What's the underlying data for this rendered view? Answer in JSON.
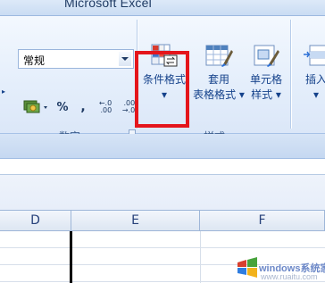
{
  "window": {
    "title": "Microsoft Excel"
  },
  "ribbon": {
    "number_group": {
      "format_value": "常规",
      "percent_label": "%",
      "comma_label": ",",
      "inc_decimal_top": "←.0",
      "inc_decimal_bottom": ".00",
      "dec_decimal_top": ".00",
      "dec_decimal_bottom": "→.0",
      "group_label": "数字"
    },
    "styles_group": {
      "conditional_formatting": {
        "label": "条件格式",
        "arrow": "▾"
      },
      "format_as_table": {
        "label_line1": "套用",
        "label_line2": "表格格式 ▾"
      },
      "cell_styles": {
        "label_line1": "单元格",
        "label_line2": "样式 ▾"
      },
      "group_label": "样式"
    },
    "cells_group": {
      "insert": {
        "label": "插入",
        "arrow": "▾"
      }
    },
    "highlight_color": "#e4151b"
  },
  "columns": [
    "D",
    "E",
    "F"
  ],
  "watermark": {
    "brand": "windows系统家园",
    "url": "www.ruaitu.com"
  }
}
